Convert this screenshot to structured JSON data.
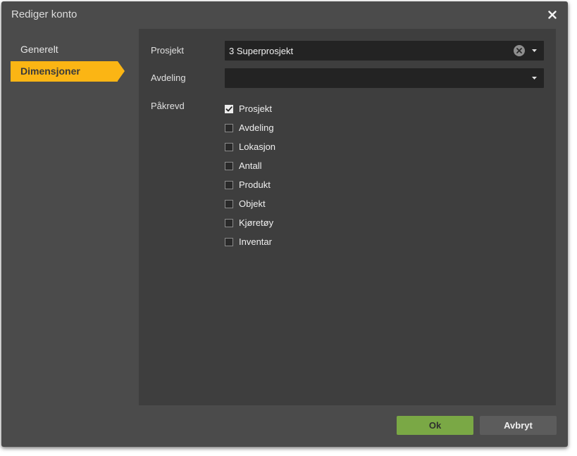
{
  "dialog": {
    "title": "Rediger konto"
  },
  "nav": {
    "items": [
      {
        "label": "Generelt",
        "active": false
      },
      {
        "label": "Dimensjoner",
        "active": true
      }
    ]
  },
  "form": {
    "prosjekt": {
      "label": "Prosjekt",
      "value": "3 Superprosjekt"
    },
    "avdeling": {
      "label": "Avdeling",
      "value": ""
    },
    "pakrevd": {
      "label": "Påkrevd",
      "options": [
        {
          "label": "Prosjekt",
          "checked": true
        },
        {
          "label": "Avdeling",
          "checked": false
        },
        {
          "label": "Lokasjon",
          "checked": false
        },
        {
          "label": "Antall",
          "checked": false
        },
        {
          "label": "Produkt",
          "checked": false
        },
        {
          "label": "Objekt",
          "checked": false
        },
        {
          "label": "Kjøretøy",
          "checked": false
        },
        {
          "label": "Inventar",
          "checked": false
        }
      ]
    }
  },
  "footer": {
    "ok_label": "Ok",
    "cancel_label": "Avbryt"
  },
  "colors": {
    "accent": "#fbb514",
    "ok": "#7aa845",
    "dialog_bg": "#4b4b4b",
    "content_bg": "#3e3e3e"
  },
  "icons": {
    "close": "close-icon",
    "clear": "clear-circle-icon",
    "caret": "caret-down-icon",
    "check": "checkmark-icon"
  }
}
